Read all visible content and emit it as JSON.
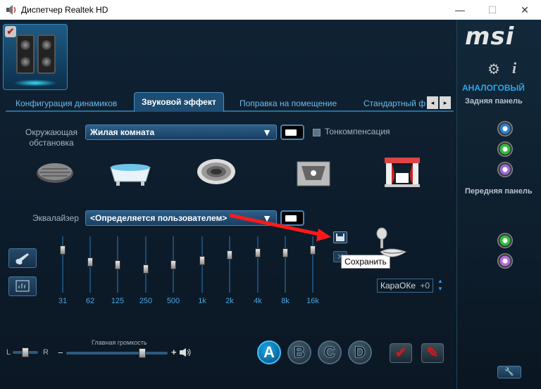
{
  "window": {
    "title": "Диспетчер Realtek HD",
    "minimize": "—",
    "maximize": "☐",
    "close": "✕"
  },
  "tabs": {
    "items": [
      {
        "label": "Конфигурация динамиков"
      },
      {
        "label": "Звуковой эффект"
      },
      {
        "label": "Поправка на помещение"
      },
      {
        "label": "Стандартный ф"
      }
    ],
    "active": "Звуковой эффект",
    "scroll_left": "◂",
    "scroll_right": "▸"
  },
  "environment": {
    "label": "Окружающая обстановка",
    "selected": "Жилая комната",
    "loudness_label": "Тонкомпенсация",
    "presets": [
      "sewer-icon",
      "bathtub-icon",
      "colosseum-icon",
      "box-room-icon",
      "stage-icon"
    ]
  },
  "equalizer": {
    "label": "Эквалайзер",
    "selected": "<Определяется пользователем>",
    "bands": [
      {
        "freq": "31",
        "level": 0.8
      },
      {
        "freq": "62",
        "level": 0.55
      },
      {
        "freq": "125",
        "level": 0.5
      },
      {
        "freq": "250",
        "level": 0.4
      },
      {
        "freq": "500",
        "level": 0.5
      },
      {
        "freq": "1k",
        "level": 0.58
      },
      {
        "freq": "2k",
        "level": 0.7
      },
      {
        "freq": "4k",
        "level": 0.75
      },
      {
        "freq": "8k",
        "level": 0.75
      },
      {
        "freq": "16k",
        "level": 0.8
      }
    ],
    "save_tooltip": "Сохранить"
  },
  "karaoke": {
    "label": "КараОКе",
    "value": "+0"
  },
  "volume": {
    "caption": "Главная громкость",
    "left": "L",
    "right": "R",
    "minus": "−",
    "plus": "+",
    "level": 0.75,
    "balance": 0.5
  },
  "profiles": {
    "items": [
      "A",
      "B",
      "C",
      "D"
    ],
    "active": "A"
  },
  "right_panel": {
    "logo": "msi",
    "analog_label": "АНАЛОГОВЫЙ",
    "rear_label": "Задняя панель",
    "front_label": "Передняя панель",
    "rear_jacks": [
      {
        "color": "#2a7fd6"
      },
      {
        "color": "#2fbf3c"
      },
      {
        "color": "#9c68d6"
      }
    ],
    "front_jacks": [
      {
        "color": "#2fbf3c"
      },
      {
        "color": "#b06be0"
      }
    ]
  }
}
